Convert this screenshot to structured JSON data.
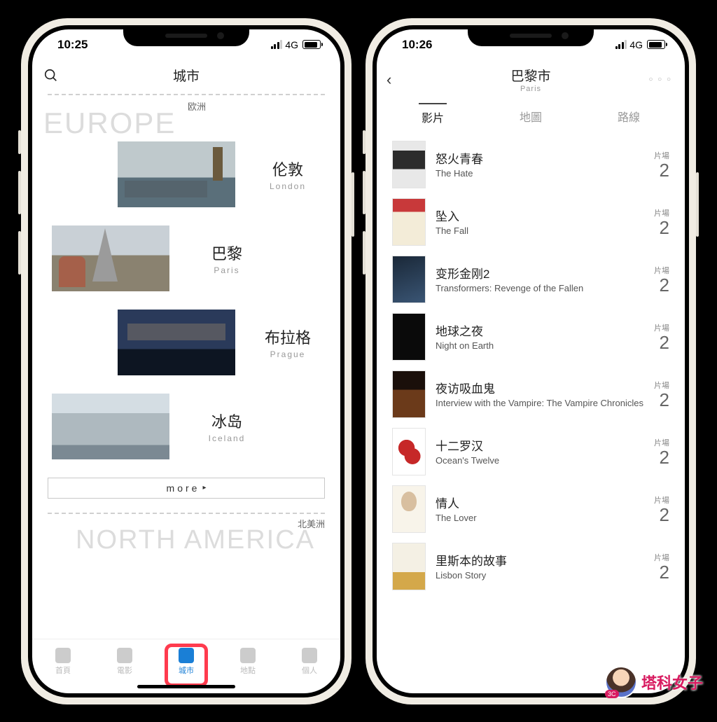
{
  "status": {
    "time_left": "10:25",
    "time_right": "10:26",
    "network": "4G"
  },
  "screen1": {
    "title": "城市",
    "sections": [
      {
        "cn": "欧洲",
        "en": "EUROPE",
        "cities": [
          {
            "cn": "伦敦",
            "en": "London",
            "align": "right",
            "thumb": "thumb-london"
          },
          {
            "cn": "巴黎",
            "en": "Paris",
            "align": "left",
            "thumb": "thumb-paris"
          },
          {
            "cn": "布拉格",
            "en": "Prague",
            "align": "right",
            "thumb": "thumb-prague"
          },
          {
            "cn": "冰岛",
            "en": "Iceland",
            "align": "left",
            "thumb": "thumb-iceland"
          }
        ],
        "more": "more"
      },
      {
        "cn": "北美洲",
        "en": "NORTH AMERICA"
      }
    ],
    "tabs": [
      {
        "label": "首頁",
        "icon": "home-icon"
      },
      {
        "label": "電影",
        "icon": "film-icon"
      },
      {
        "label": "城市",
        "icon": "city-icon",
        "active": true
      },
      {
        "label": "地點",
        "icon": "pin-icon"
      },
      {
        "label": "個人",
        "icon": "profile-icon"
      }
    ]
  },
  "screen2": {
    "title_cn": "巴黎市",
    "title_en": "Paris",
    "back": "‹",
    "more": "○ ○ ○",
    "seg_tabs": [
      {
        "label": "影片",
        "active": true
      },
      {
        "label": "地圖"
      },
      {
        "label": "路線"
      }
    ],
    "count_label": "片場",
    "movies": [
      {
        "cn": "怒火青春",
        "en": "The Hate",
        "count": "2",
        "p": "p0"
      },
      {
        "cn": "坠入",
        "en": "The Fall",
        "count": "2",
        "p": "p1"
      },
      {
        "cn": "变形金刚2",
        "en": "Transformers: Revenge of the Fallen",
        "count": "2",
        "p": "p2"
      },
      {
        "cn": "地球之夜",
        "en": "Night on Earth",
        "count": "2",
        "p": "p3"
      },
      {
        "cn": "夜访吸血鬼",
        "en": "Interview with the Vampire: The Vampire Chronicles",
        "count": "2",
        "p": "p4"
      },
      {
        "cn": "十二罗汉",
        "en": "Ocean's Twelve",
        "count": "2",
        "p": "p5"
      },
      {
        "cn": "情人",
        "en": "The Lover",
        "count": "2",
        "p": "p6"
      },
      {
        "cn": "里斯本的故事",
        "en": "Lisbon Story",
        "count": "2",
        "p": "p7"
      }
    ]
  },
  "watermark": "塔科女子"
}
